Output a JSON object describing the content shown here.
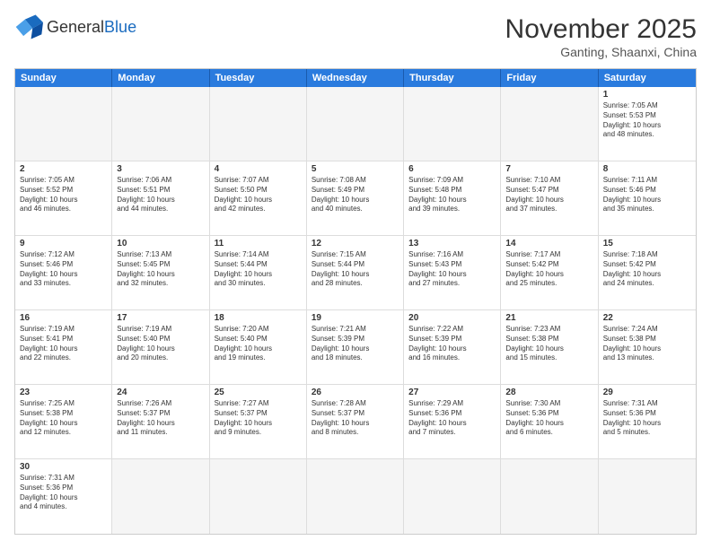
{
  "header": {
    "logo_general": "General",
    "logo_blue": "Blue",
    "month_year": "November 2025",
    "location": "Ganting, Shaanxi, China"
  },
  "days_of_week": [
    "Sunday",
    "Monday",
    "Tuesday",
    "Wednesday",
    "Thursday",
    "Friday",
    "Saturday"
  ],
  "cells": [
    {
      "day": "",
      "empty": true,
      "info": ""
    },
    {
      "day": "",
      "empty": true,
      "info": ""
    },
    {
      "day": "",
      "empty": true,
      "info": ""
    },
    {
      "day": "",
      "empty": true,
      "info": ""
    },
    {
      "day": "",
      "empty": true,
      "info": ""
    },
    {
      "day": "",
      "empty": true,
      "info": ""
    },
    {
      "day": "1",
      "empty": false,
      "info": "Sunrise: 7:05 AM\nSunset: 5:53 PM\nDaylight: 10 hours\nand 48 minutes."
    },
    {
      "day": "2",
      "empty": false,
      "info": "Sunrise: 7:05 AM\nSunset: 5:52 PM\nDaylight: 10 hours\nand 46 minutes."
    },
    {
      "day": "3",
      "empty": false,
      "info": "Sunrise: 7:06 AM\nSunset: 5:51 PM\nDaylight: 10 hours\nand 44 minutes."
    },
    {
      "day": "4",
      "empty": false,
      "info": "Sunrise: 7:07 AM\nSunset: 5:50 PM\nDaylight: 10 hours\nand 42 minutes."
    },
    {
      "day": "5",
      "empty": false,
      "info": "Sunrise: 7:08 AM\nSunset: 5:49 PM\nDaylight: 10 hours\nand 40 minutes."
    },
    {
      "day": "6",
      "empty": false,
      "info": "Sunrise: 7:09 AM\nSunset: 5:48 PM\nDaylight: 10 hours\nand 39 minutes."
    },
    {
      "day": "7",
      "empty": false,
      "info": "Sunrise: 7:10 AM\nSunset: 5:47 PM\nDaylight: 10 hours\nand 37 minutes."
    },
    {
      "day": "8",
      "empty": false,
      "info": "Sunrise: 7:11 AM\nSunset: 5:46 PM\nDaylight: 10 hours\nand 35 minutes."
    },
    {
      "day": "9",
      "empty": false,
      "info": "Sunrise: 7:12 AM\nSunset: 5:46 PM\nDaylight: 10 hours\nand 33 minutes."
    },
    {
      "day": "10",
      "empty": false,
      "info": "Sunrise: 7:13 AM\nSunset: 5:45 PM\nDaylight: 10 hours\nand 32 minutes."
    },
    {
      "day": "11",
      "empty": false,
      "info": "Sunrise: 7:14 AM\nSunset: 5:44 PM\nDaylight: 10 hours\nand 30 minutes."
    },
    {
      "day": "12",
      "empty": false,
      "info": "Sunrise: 7:15 AM\nSunset: 5:44 PM\nDaylight: 10 hours\nand 28 minutes."
    },
    {
      "day": "13",
      "empty": false,
      "info": "Sunrise: 7:16 AM\nSunset: 5:43 PM\nDaylight: 10 hours\nand 27 minutes."
    },
    {
      "day": "14",
      "empty": false,
      "info": "Sunrise: 7:17 AM\nSunset: 5:42 PM\nDaylight: 10 hours\nand 25 minutes."
    },
    {
      "day": "15",
      "empty": false,
      "info": "Sunrise: 7:18 AM\nSunset: 5:42 PM\nDaylight: 10 hours\nand 24 minutes."
    },
    {
      "day": "16",
      "empty": false,
      "info": "Sunrise: 7:19 AM\nSunset: 5:41 PM\nDaylight: 10 hours\nand 22 minutes."
    },
    {
      "day": "17",
      "empty": false,
      "info": "Sunrise: 7:19 AM\nSunset: 5:40 PM\nDaylight: 10 hours\nand 20 minutes."
    },
    {
      "day": "18",
      "empty": false,
      "info": "Sunrise: 7:20 AM\nSunset: 5:40 PM\nDaylight: 10 hours\nand 19 minutes."
    },
    {
      "day": "19",
      "empty": false,
      "info": "Sunrise: 7:21 AM\nSunset: 5:39 PM\nDaylight: 10 hours\nand 18 minutes."
    },
    {
      "day": "20",
      "empty": false,
      "info": "Sunrise: 7:22 AM\nSunset: 5:39 PM\nDaylight: 10 hours\nand 16 minutes."
    },
    {
      "day": "21",
      "empty": false,
      "info": "Sunrise: 7:23 AM\nSunset: 5:38 PM\nDaylight: 10 hours\nand 15 minutes."
    },
    {
      "day": "22",
      "empty": false,
      "info": "Sunrise: 7:24 AM\nSunset: 5:38 PM\nDaylight: 10 hours\nand 13 minutes."
    },
    {
      "day": "23",
      "empty": false,
      "info": "Sunrise: 7:25 AM\nSunset: 5:38 PM\nDaylight: 10 hours\nand 12 minutes."
    },
    {
      "day": "24",
      "empty": false,
      "info": "Sunrise: 7:26 AM\nSunset: 5:37 PM\nDaylight: 10 hours\nand 11 minutes."
    },
    {
      "day": "25",
      "empty": false,
      "info": "Sunrise: 7:27 AM\nSunset: 5:37 PM\nDaylight: 10 hours\nand 9 minutes."
    },
    {
      "day": "26",
      "empty": false,
      "info": "Sunrise: 7:28 AM\nSunset: 5:37 PM\nDaylight: 10 hours\nand 8 minutes."
    },
    {
      "day": "27",
      "empty": false,
      "info": "Sunrise: 7:29 AM\nSunset: 5:36 PM\nDaylight: 10 hours\nand 7 minutes."
    },
    {
      "day": "28",
      "empty": false,
      "info": "Sunrise: 7:30 AM\nSunset: 5:36 PM\nDaylight: 10 hours\nand 6 minutes."
    },
    {
      "day": "29",
      "empty": false,
      "info": "Sunrise: 7:31 AM\nSunset: 5:36 PM\nDaylight: 10 hours\nand 5 minutes."
    },
    {
      "day": "30",
      "empty": false,
      "info": "Sunrise: 7:31 AM\nSunset: 5:36 PM\nDaylight: 10 hours\nand 4 minutes."
    },
    {
      "day": "",
      "empty": true,
      "info": ""
    },
    {
      "day": "",
      "empty": true,
      "info": ""
    },
    {
      "day": "",
      "empty": true,
      "info": ""
    },
    {
      "day": "",
      "empty": true,
      "info": ""
    },
    {
      "day": "",
      "empty": true,
      "info": ""
    },
    {
      "day": "",
      "empty": true,
      "info": ""
    }
  ]
}
